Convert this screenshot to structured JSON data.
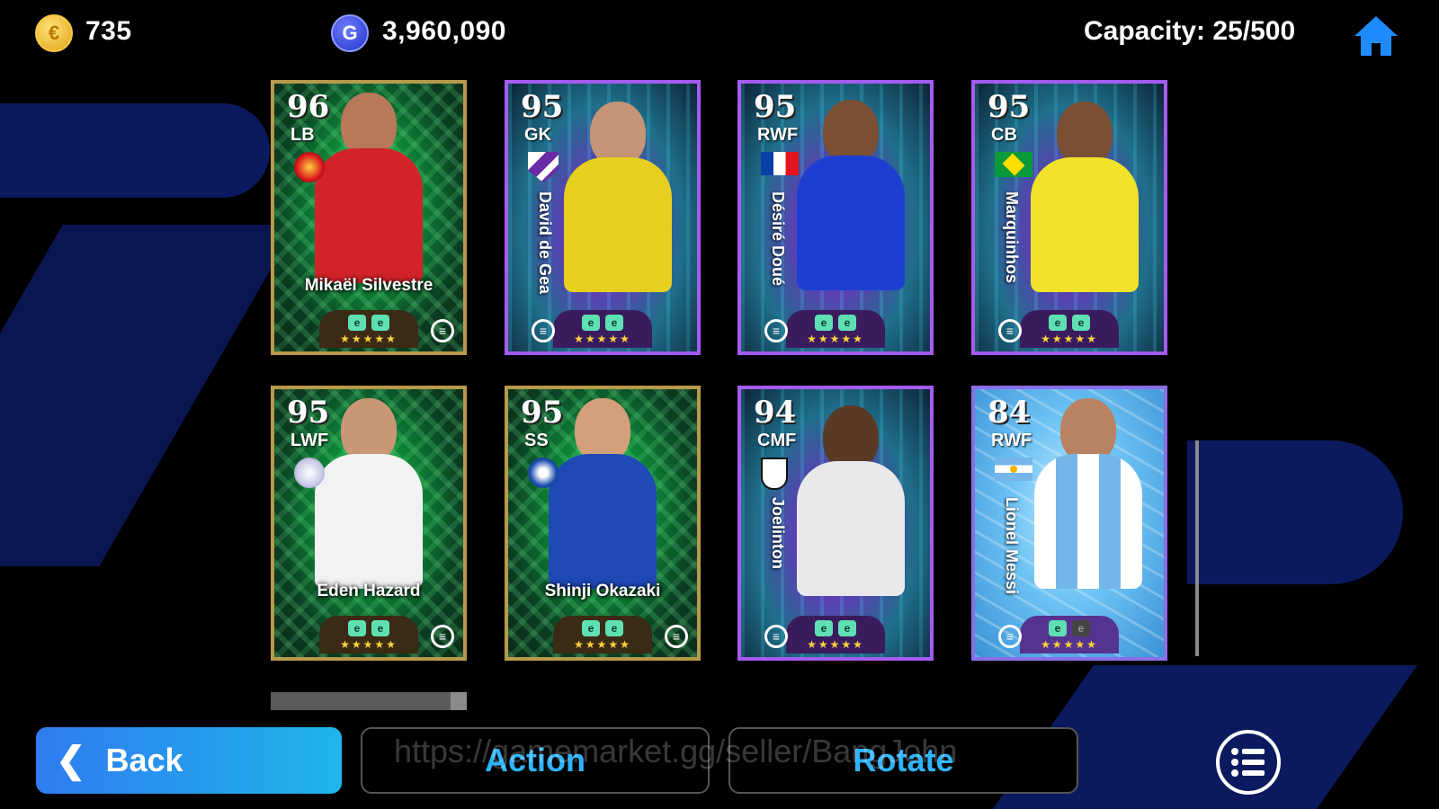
{
  "header": {
    "coins": "735",
    "gp": "3,960,090",
    "capacity": "Capacity: 25/500",
    "coin_icon_label": "€",
    "gp_icon_label": "G"
  },
  "cards": [
    {
      "rating": "96",
      "position": "LB",
      "name": "Mikaël Silvestre",
      "style": "gold"
    },
    {
      "rating": "95",
      "position": "GK",
      "name": "David de Gea",
      "style": "purple"
    },
    {
      "rating": "95",
      "position": "RWF",
      "name": "Désiré Doué",
      "style": "purple"
    },
    {
      "rating": "95",
      "position": "CB",
      "name": "Marquinhos",
      "style": "purple"
    },
    {
      "rating": "95",
      "position": "LWF",
      "name": "Eden Hazard",
      "style": "gold"
    },
    {
      "rating": "95",
      "position": "SS",
      "name": "Shinji Okazaki",
      "style": "gold"
    },
    {
      "rating": "94",
      "position": "CMF",
      "name": "Joelinton",
      "style": "purple"
    },
    {
      "rating": "84",
      "position": "RWF",
      "name": "Lionel Messi",
      "style": "blue"
    }
  ],
  "card_common": {
    "stars": "★★★★★",
    "skill_glyph": "e"
  },
  "footer": {
    "back_label": "Back",
    "action_label": "Action",
    "rotate_label": "Rotate",
    "watermark": "https://gamemarket.gg/seller/BangJohn"
  },
  "colors": {
    "accent_blue": "#2eb4ff",
    "back_gradient_start": "#2f7cf0",
    "back_gradient_end": "#1fb6ea"
  },
  "icons": [
    "coin-icon",
    "gp-icon",
    "home-icon",
    "chevron-left-icon",
    "list-menu-icon"
  ]
}
